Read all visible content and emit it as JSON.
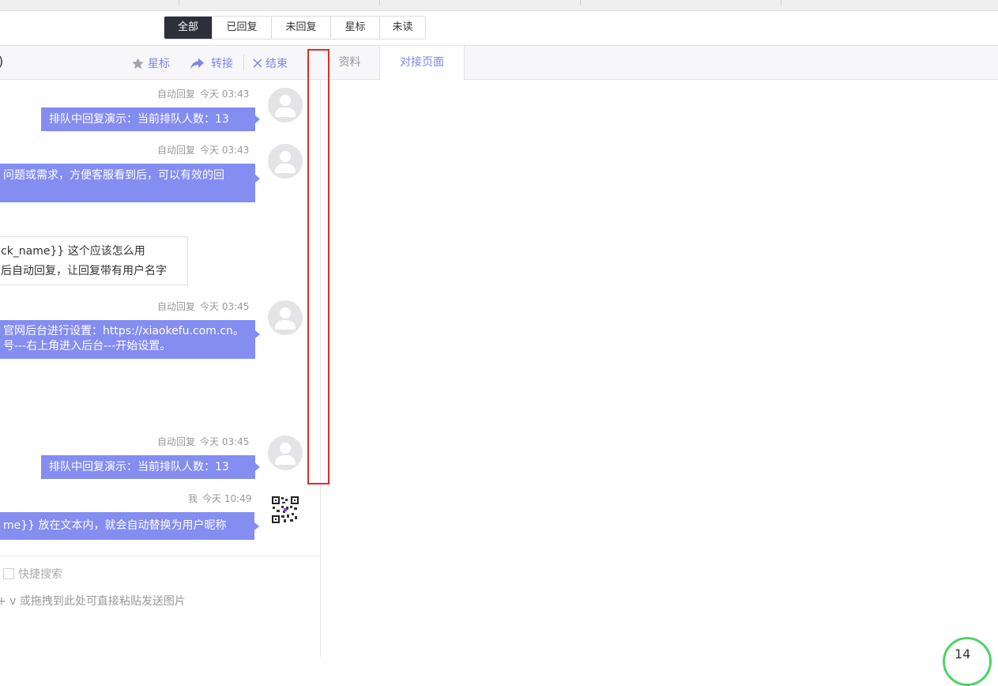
{
  "filter_tabs": [
    {
      "label": "全部",
      "active": true
    },
    {
      "label": "已回复",
      "active": false
    },
    {
      "label": "未回复",
      "active": false
    },
    {
      "label": "星标",
      "active": false
    },
    {
      "label": "未读",
      "active": false
    }
  ],
  "chat_header": {
    "title_fragment": ")",
    "star_label": "星标",
    "transfer_label": "转接",
    "end_label": "结束"
  },
  "right_tabs": {
    "info": "资料",
    "docking_page": "对接页面"
  },
  "messages": [
    {
      "sender": "自动回复",
      "time": "今天 03:43",
      "lines": [
        "排队中回复演示：当前排队人数：13"
      ]
    },
    {
      "sender": "自动回复",
      "time": "今天 03:43",
      "lines": [
        "问题或需求，方便客服看到后，可以有效的回",
        ""
      ]
    },
    {
      "sender": "",
      "time": "",
      "lines": [
        "ck_name}}   这个应该怎么用",
        "后自动回复，让回复带有用户名字"
      ]
    },
    {
      "sender": "自动回复",
      "time": "今天 03:45",
      "lines": [
        "官网后台进行设置：https://xiaokefu.com.cn。",
        "号---右上角进入后台---开始设置。"
      ]
    },
    {
      "sender": "自动回复",
      "time": "今天 03:45",
      "lines": [
        "排队中回复演示：当前排队人数：13"
      ]
    },
    {
      "sender": "我",
      "time": "今天 10:49",
      "lines": [
        "me}}    放在文本内，就会自动替换为用户昵称"
      ]
    }
  ],
  "input_area": {
    "quick_search_label": "快捷搜索",
    "paste_hint": "+ v 或拖拽到此处可直接粘贴发送图片"
  },
  "corner_widget": {
    "text": "14"
  },
  "colors": {
    "accent": "#848df0",
    "accent_text": "#7b86e8",
    "active_tab_bg": "#2d2f3b",
    "selection_box": "#e02a2a",
    "progress_ring": "#4cd366"
  }
}
